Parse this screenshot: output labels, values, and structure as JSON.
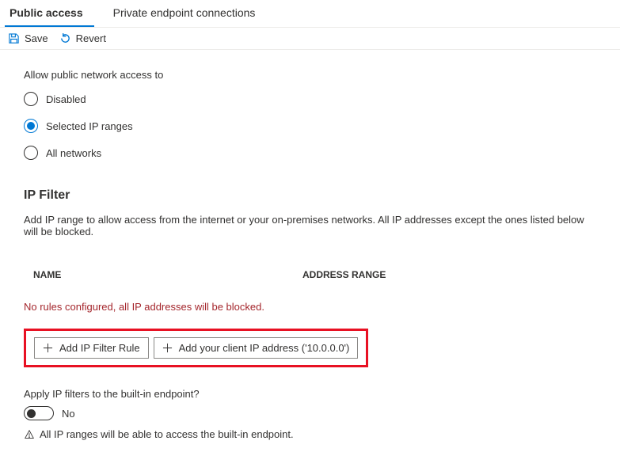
{
  "tabs": {
    "public_access": "Public access",
    "private_endpoint": "Private endpoint connections"
  },
  "toolbar": {
    "save": "Save",
    "revert": "Revert"
  },
  "access": {
    "label": "Allow public network access to",
    "options": {
      "disabled": "Disabled",
      "selected_ip": "Selected IP ranges",
      "all": "All networks"
    }
  },
  "ip_filter": {
    "heading": "IP Filter",
    "description": "Add IP range to allow access from the internet or your on-premises networks. All IP addresses except the ones listed below will be blocked.",
    "columns": {
      "name": "NAME",
      "address_range": "ADDRESS RANGE"
    },
    "empty_message": "No rules configured, all IP addresses will be blocked.",
    "add_rule": "Add IP Filter Rule",
    "add_client_ip": "Add your client IP address ('10.0.0.0')"
  },
  "builtin": {
    "label": "Apply IP filters to the built-in endpoint?",
    "toggle_value": "No",
    "info": "All IP ranges will be able to access the built-in endpoint."
  }
}
